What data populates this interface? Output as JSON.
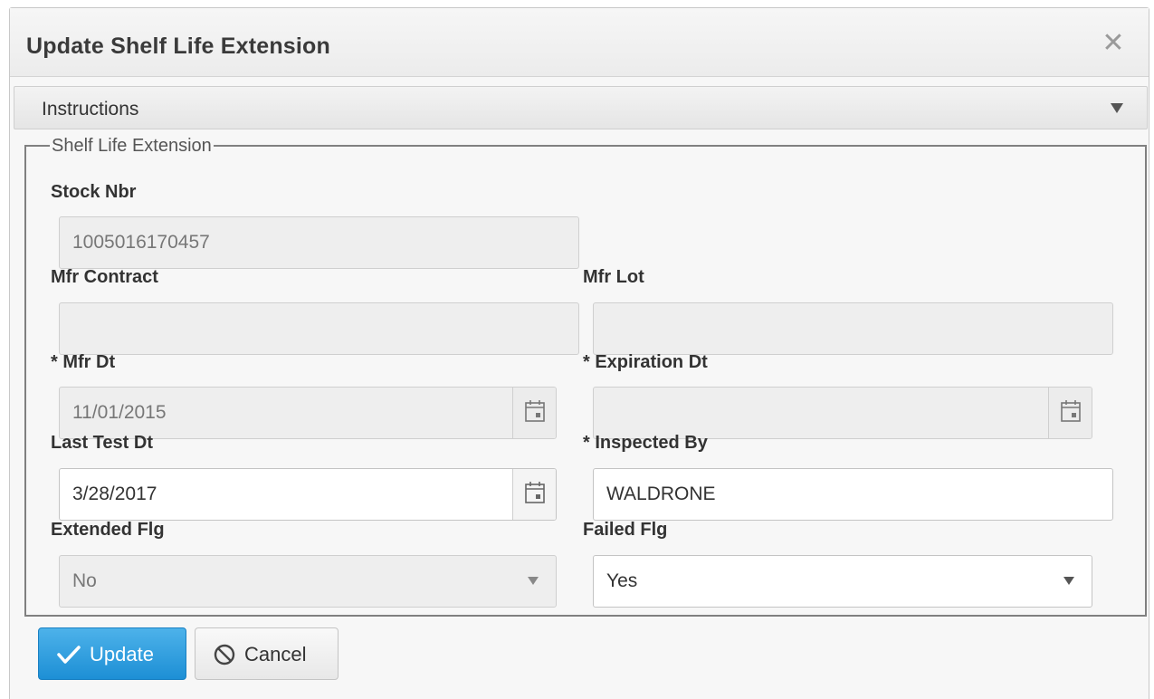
{
  "dialog": {
    "title": "Update Shelf Life Extension",
    "close_icon": "close-icon"
  },
  "instructions": {
    "label": "Instructions",
    "icon": "caret-down-icon"
  },
  "form": {
    "legend": "Shelf Life Extension",
    "stock_nbr": {
      "label": "Stock Nbr",
      "value": "1005016170457"
    },
    "mfr_contract": {
      "label": "Mfr Contract",
      "value": ""
    },
    "mfr_lot": {
      "label": "Mfr Lot",
      "value": ""
    },
    "mfr_dt": {
      "label": "* Mfr Dt",
      "value": "11/01/2015",
      "icon": "calendar-icon"
    },
    "expiration_dt": {
      "label": "* Expiration Dt",
      "value": "",
      "icon": "calendar-icon"
    },
    "last_test_dt": {
      "label": "Last Test Dt",
      "value": "3/28/2017",
      "icon": "calendar-icon"
    },
    "inspected_by": {
      "label": "* Inspected By",
      "value": "WALDRONE"
    },
    "extended_flg": {
      "label": "Extended Flg",
      "value": "No",
      "icon": "caret-down-icon"
    },
    "failed_flg": {
      "label": "Failed Flg",
      "value": "Yes",
      "icon": "caret-down-icon"
    }
  },
  "buttons": {
    "update_label": "Update",
    "update_icon": "checkmark-icon",
    "cancel_label": "Cancel",
    "cancel_icon": "ban-icon"
  },
  "colors": {
    "primary_button": "#2b9ee0",
    "disabled_field": "#eeeeee",
    "border": "#cfcfcf"
  }
}
